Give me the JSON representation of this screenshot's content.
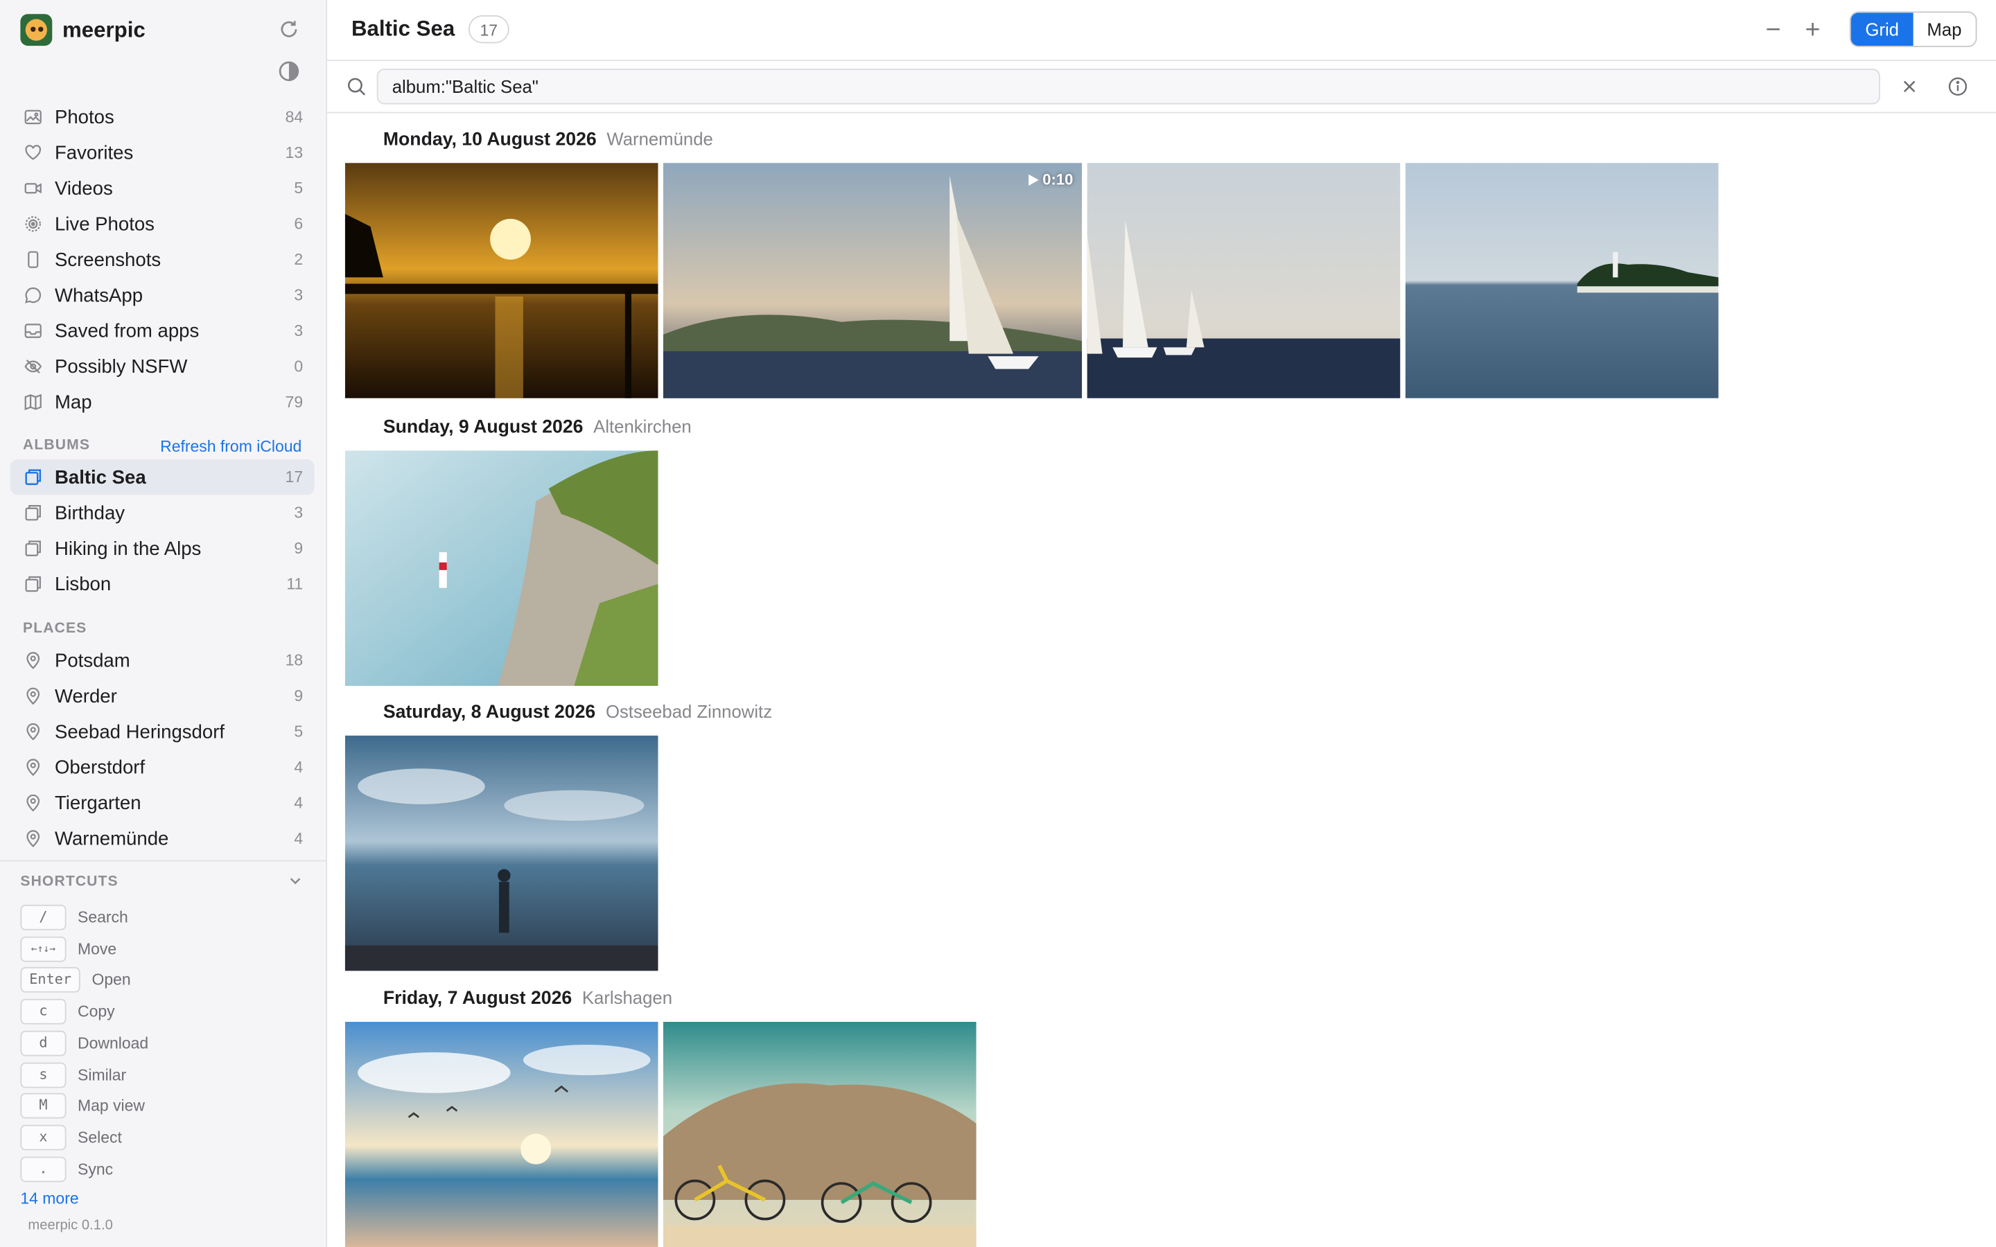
{
  "app": {
    "name": "meerpic",
    "version": "meerpic 0.1.0"
  },
  "library": [
    {
      "label": "Photos",
      "count": "84",
      "icon": "photo-icon"
    },
    {
      "label": "Favorites",
      "count": "13",
      "icon": "heart-icon"
    },
    {
      "label": "Videos",
      "count": "5",
      "icon": "video-icon"
    },
    {
      "label": "Live Photos",
      "count": "6",
      "icon": "live-photo-icon"
    },
    {
      "label": "Screenshots",
      "count": "2",
      "icon": "phone-icon"
    },
    {
      "label": "WhatsApp",
      "count": "3",
      "icon": "chat-bubble-icon"
    },
    {
      "label": "Saved from apps",
      "count": "3",
      "icon": "inbox-icon"
    },
    {
      "label": "Possibly NSFW",
      "count": "0",
      "icon": "eye-off-icon"
    },
    {
      "label": "Map",
      "count": "79",
      "icon": "map-icon"
    }
  ],
  "albums": {
    "heading": "ALBUMS",
    "refresh_label": "Refresh from iCloud",
    "items": [
      {
        "label": "Baltic Sea",
        "count": "17",
        "active": true
      },
      {
        "label": "Birthday",
        "count": "3"
      },
      {
        "label": "Hiking in the Alps",
        "count": "9"
      },
      {
        "label": "Lisbon",
        "count": "11"
      }
    ]
  },
  "places": {
    "heading": "PLACES",
    "items": [
      {
        "label": "Potsdam",
        "count": "18"
      },
      {
        "label": "Werder",
        "count": "9"
      },
      {
        "label": "Seebad Heringsdorf",
        "count": "5"
      },
      {
        "label": "Oberstdorf",
        "count": "4"
      },
      {
        "label": "Tiergarten",
        "count": "4"
      },
      {
        "label": "Warnemünde",
        "count": "4"
      }
    ]
  },
  "shortcuts": {
    "heading": "SHORTCUTS",
    "items": [
      {
        "key": "/",
        "label": "Search"
      },
      {
        "key": "←↑↓→",
        "label": "Move"
      },
      {
        "key": "Enter",
        "label": "Open"
      },
      {
        "key": "c",
        "label": "Copy"
      },
      {
        "key": "d",
        "label": "Download"
      },
      {
        "key": "s",
        "label": "Similar"
      },
      {
        "key": "M",
        "label": "Map view"
      },
      {
        "key": "x",
        "label": "Select"
      },
      {
        "key": ".",
        "label": "Sync"
      }
    ],
    "more_label": "14 more"
  },
  "header": {
    "title": "Baltic Sea",
    "count": "17",
    "view_modes": [
      "Grid",
      "Map"
    ],
    "active_view": "Grid"
  },
  "search": {
    "value": "album:\"Baltic Sea\""
  },
  "days": [
    {
      "date": "Monday, 10 August 2026",
      "location": "Warnemünde",
      "video_duration": "0:10"
    },
    {
      "date": "Sunday, 9 August 2026",
      "location": "Altenkirchen"
    },
    {
      "date": "Saturday, 8 August 2026",
      "location": "Ostseebad Zinnowitz"
    },
    {
      "date": "Friday, 7 August 2026",
      "location": "Karlshagen"
    }
  ],
  "colors": {
    "accent": "#1a73e8",
    "sidebar_bg": "#f5f5f7",
    "active_item_bg": "#e6e8ef"
  }
}
